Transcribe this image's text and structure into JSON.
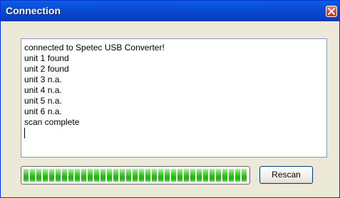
{
  "window": {
    "title": "Connection"
  },
  "log": {
    "lines": [
      "connected to Spetec USB Converter!",
      "unit 1 found",
      "unit 2 found",
      "unit 3 n.a.",
      "unit 4 n.a.",
      "unit 5 n.a.",
      "unit 6 n.a.",
      "scan complete"
    ]
  },
  "progress": {
    "fraction": 1.0,
    "color": "#26b414"
  },
  "buttons": {
    "rescan_label": "Rescan"
  },
  "icons": {
    "close": "close-icon"
  },
  "colors": {
    "titlebar": "#0848d1",
    "window_bg": "#ece9d8",
    "close_button": "#d6482a"
  }
}
